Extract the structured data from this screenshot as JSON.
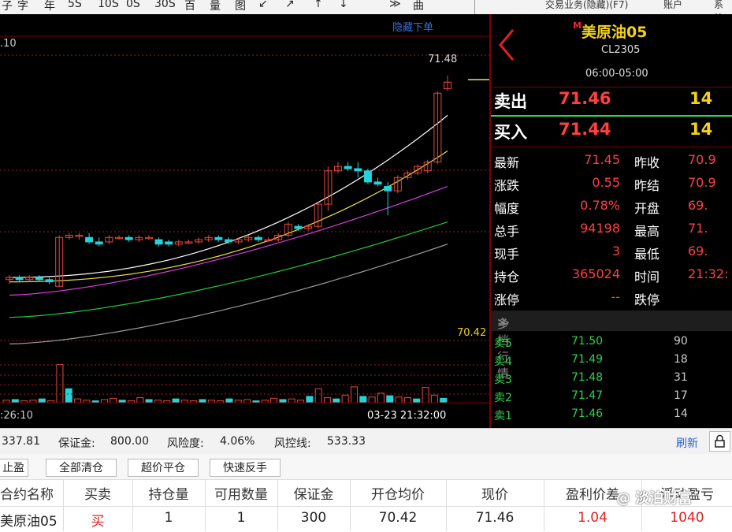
{
  "toolbar_glyphs": [
    "子",
    "字",
    "年",
    "5S",
    "10S",
    "0S",
    "30S",
    "百",
    "量",
    "图",
    "↙",
    "↗",
    "↑",
    "↓",
    "≫",
    "曲"
  ],
  "top_right": [
    "交易业务(隐藏)(F7)",
    "账户",
    "系统"
  ],
  "chart": {
    "hide_orders_label": "隐藏下单",
    "price_axis_top_label": ".10",
    "high_label": "71.48",
    "low_label": "70.42",
    "time_left": ":26:10",
    "time_right": "03-23 21:32:00",
    "colors": {
      "up": "#e8463c",
      "down": "#22d3d9",
      "ma5": "#ffffff",
      "ma10": "#f0e04a",
      "ma20": "#d93ee0",
      "ma40": "#22c93c",
      "ma60": "#9a9a9a",
      "dash": "#9b1c1c"
    }
  },
  "chart_data": {
    "type": "candlestick",
    "title": "",
    "ylim": [
      70.3,
      71.55
    ],
    "candles": [
      {
        "o": 70.56,
        "h": 70.58,
        "l": 70.54,
        "c": 70.57
      },
      {
        "o": 70.57,
        "h": 70.58,
        "l": 70.55,
        "c": 70.56
      },
      {
        "o": 70.56,
        "h": 70.58,
        "l": 70.55,
        "c": 70.57
      },
      {
        "o": 70.57,
        "h": 70.58,
        "l": 70.55,
        "c": 70.56
      },
      {
        "o": 70.56,
        "h": 70.57,
        "l": 70.54,
        "c": 70.55
      },
      {
        "o": 70.53,
        "h": 70.76,
        "l": 70.53,
        "c": 70.75
      },
      {
        "o": 70.75,
        "h": 70.77,
        "l": 70.74,
        "c": 70.76
      },
      {
        "o": 70.76,
        "h": 70.77,
        "l": 70.74,
        "c": 70.76
      },
      {
        "o": 70.75,
        "h": 70.77,
        "l": 70.72,
        "c": 70.73
      },
      {
        "o": 70.73,
        "h": 70.75,
        "l": 70.71,
        "c": 70.72
      },
      {
        "o": 70.73,
        "h": 70.76,
        "l": 70.72,
        "c": 70.75
      },
      {
        "o": 70.75,
        "h": 70.76,
        "l": 70.74,
        "c": 70.75
      },
      {
        "o": 70.75,
        "h": 70.76,
        "l": 70.73,
        "c": 70.74
      },
      {
        "o": 70.74,
        "h": 70.76,
        "l": 70.73,
        "c": 70.75
      },
      {
        "o": 70.75,
        "h": 70.76,
        "l": 70.74,
        "c": 70.75
      },
      {
        "o": 70.74,
        "h": 70.75,
        "l": 70.71,
        "c": 70.72
      },
      {
        "o": 70.73,
        "h": 70.74,
        "l": 70.71,
        "c": 70.72
      },
      {
        "o": 70.72,
        "h": 70.74,
        "l": 70.71,
        "c": 70.73
      },
      {
        "o": 70.73,
        "h": 70.74,
        "l": 70.72,
        "c": 70.73
      },
      {
        "o": 70.73,
        "h": 70.75,
        "l": 70.72,
        "c": 70.74
      },
      {
        "o": 70.74,
        "h": 70.76,
        "l": 70.73,
        "c": 70.75
      },
      {
        "o": 70.75,
        "h": 70.76,
        "l": 70.73,
        "c": 70.74
      },
      {
        "o": 70.74,
        "h": 70.75,
        "l": 70.72,
        "c": 70.73
      },
      {
        "o": 70.73,
        "h": 70.75,
        "l": 70.72,
        "c": 70.74
      },
      {
        "o": 70.74,
        "h": 70.76,
        "l": 70.73,
        "c": 70.75
      },
      {
        "o": 70.75,
        "h": 70.76,
        "l": 70.73,
        "c": 70.74
      },
      {
        "o": 70.74,
        "h": 70.75,
        "l": 70.73,
        "c": 70.74
      },
      {
        "o": 70.74,
        "h": 70.77,
        "l": 70.73,
        "c": 70.76
      },
      {
        "o": 70.76,
        "h": 70.82,
        "l": 70.75,
        "c": 70.81
      },
      {
        "o": 70.8,
        "h": 70.81,
        "l": 70.78,
        "c": 70.79
      },
      {
        "o": 70.79,
        "h": 70.81,
        "l": 70.78,
        "c": 70.8
      },
      {
        "o": 70.8,
        "h": 70.91,
        "l": 70.79,
        "c": 70.9
      },
      {
        "o": 70.9,
        "h": 71.07,
        "l": 70.87,
        "c": 71.05
      },
      {
        "o": 71.05,
        "h": 71.09,
        "l": 71.04,
        "c": 71.07
      },
      {
        "o": 71.07,
        "h": 71.09,
        "l": 71.05,
        "c": 71.06
      },
      {
        "o": 71.06,
        "h": 71.09,
        "l": 71.02,
        "c": 71.05
      },
      {
        "o": 71.05,
        "h": 71.06,
        "l": 70.99,
        "c": 71.0
      },
      {
        "o": 71.0,
        "h": 71.02,
        "l": 70.98,
        "c": 70.99
      },
      {
        "o": 70.98,
        "h": 71.0,
        "l": 70.85,
        "c": 70.96
      },
      {
        "o": 70.96,
        "h": 71.03,
        "l": 70.95,
        "c": 71.02
      },
      {
        "o": 71.02,
        "h": 71.05,
        "l": 71.01,
        "c": 71.04
      },
      {
        "o": 71.04,
        "h": 71.08,
        "l": 71.03,
        "c": 71.07
      },
      {
        "o": 71.05,
        "h": 71.1,
        "l": 71.04,
        "c": 71.09
      },
      {
        "o": 71.09,
        "h": 71.41,
        "l": 71.08,
        "c": 71.4
      },
      {
        "o": 71.42,
        "h": 71.48,
        "l": 71.41,
        "c": 71.45
      }
    ],
    "ma_series": [
      {
        "name": "MA5",
        "start": [
          70.57,
          0
        ],
        "end": [
          71.3,
          44
        ]
      },
      {
        "name": "MA10",
        "start": [
          70.55,
          0
        ],
        "end": [
          71.14,
          44
        ]
      },
      {
        "name": "MA20",
        "start": [
          70.49,
          0
        ],
        "end": [
          70.98,
          44
        ]
      },
      {
        "name": "MA40",
        "start": [
          70.39,
          0
        ],
        "end": [
          70.82,
          44
        ]
      },
      {
        "name": "MA60",
        "start": [
          70.27,
          0
        ],
        "end": [
          70.72,
          44
        ]
      }
    ],
    "volume": [
      4,
      5,
      3,
      4,
      6,
      3,
      60,
      22,
      6,
      4,
      3,
      5,
      7,
      4,
      3,
      8,
      5,
      4,
      3,
      6,
      4,
      3,
      5,
      4,
      3,
      6,
      4,
      5,
      3,
      4,
      7,
      5,
      6,
      4,
      10,
      22,
      8,
      6,
      12,
      25,
      10,
      9,
      15,
      11,
      9,
      8,
      6,
      24,
      12,
      7
    ]
  },
  "panel": {
    "symbol_marker": "M",
    "symbol": "美原油05",
    "code": "CL2305",
    "session": "06:00-05:00",
    "ask_label": "卖出",
    "ask_price": "71.46",
    "ask_qty": "14",
    "bid_label": "买入",
    "bid_price": "71.44",
    "bid_qty": "14",
    "quotes": [
      {
        "k1": "最新",
        "v1": "71.45",
        "k2": "昨收",
        "v2": "70.9"
      },
      {
        "k1": "涨跌",
        "v1": "0.55",
        "k2": "昨结",
        "v2": "70.9"
      },
      {
        "k1": "幅度",
        "v1": "0.78%",
        "k2": "开盘",
        "v2": "69."
      },
      {
        "k1": "总手",
        "v1": "94198",
        "k2": "最高",
        "v2": "71."
      },
      {
        "k1": "现手",
        "v1": "3",
        "k2": "最低",
        "v2": "69."
      },
      {
        "k1": "持仓",
        "v1": "365024",
        "k2": "时间",
        "v2": "21:32:"
      },
      {
        "k1": "涨停",
        "v1": "--",
        "k2": "跌停",
        "v2": ""
      }
    ],
    "depth_title": "多档行情",
    "depth": [
      {
        "k": "卖5",
        "p": "71.50",
        "q": "90"
      },
      {
        "k": "卖4",
        "p": "71.49",
        "q": "18"
      },
      {
        "k": "卖3",
        "p": "71.48",
        "q": "31"
      },
      {
        "k": "卖2",
        "p": "71.47",
        "q": "17"
      },
      {
        "k": "卖1",
        "p": "71.46",
        "q": "14"
      }
    ]
  },
  "account": {
    "balance": "337.81",
    "margin_label": "保证金:",
    "margin": "800.00",
    "risk_label": "风险度:",
    "risk": "4.06%",
    "riskline_label": "风控线:",
    "riskline": "533.33",
    "refresh": "刷新"
  },
  "actions": [
    "止盈",
    "全部清仓",
    "超价平仓",
    "快速反手"
  ],
  "positions": {
    "headers": [
      "合约名称",
      "买卖",
      "持仓量",
      "可用数量",
      "保证金",
      "开仓均价",
      "现价",
      "盈利价差",
      "浮动盈亏"
    ],
    "rows": [
      [
        "美原油05",
        "买",
        "1",
        "1",
        "300",
        "70.42",
        "71.46",
        "1.04",
        "1040"
      ]
    ]
  },
  "watermark": "@ 淡泊财富"
}
